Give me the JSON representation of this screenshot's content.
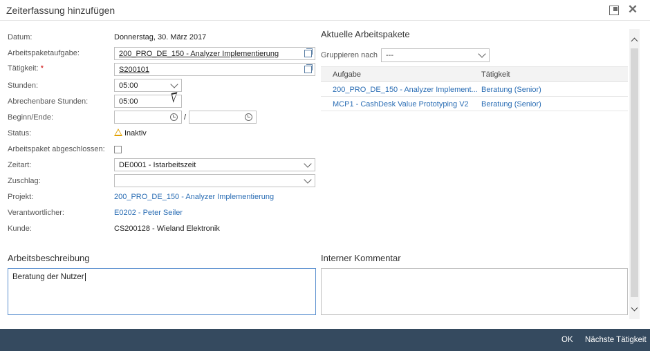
{
  "dialog": {
    "title": "Zeiterfassung hinzufügen"
  },
  "form": {
    "datum_label": "Datum:",
    "datum_value": "Donnerstag, 30. März 2017",
    "arbeitspaketaufgabe_label": "Arbeitspaketaufgabe:",
    "arbeitspaketaufgabe_value": "200_PRO_DE_150 - Analyzer Implementierung",
    "taetigkeit_label": "Tätigkeit:",
    "required_marker": "*",
    "taetigkeit_value": "S200101",
    "stunden_label": "Stunden:",
    "stunden_value": "05:00",
    "abrechenbare_label": "Abrechenbare Stunden:",
    "abrechenbare_value": "05:00",
    "beginn_ende_label": "Beginn/Ende:",
    "beginn_value": "",
    "separator": "/",
    "ende_value": "",
    "status_label": "Status:",
    "status_value": "Inaktiv",
    "abgeschlossen_label": "Arbeitspaket abgeschlossen:",
    "zeitart_label": "Zeitart:",
    "zeitart_value": "DE0001 - Istarbeitszeit",
    "zuschlag_label": "Zuschlag:",
    "zuschlag_value": "",
    "projekt_label": "Projekt:",
    "projekt_value": "200_PRO_DE_150 - Analyzer Implementierung",
    "verantwortlicher_label": "Verantwortlicher:",
    "verantwortlicher_value": "E0202 - Peter Seiler",
    "kunde_label": "Kunde:",
    "kunde_value": "CS200128 - Wieland Elektronik"
  },
  "packages": {
    "heading": "Aktuelle Arbeitspakete",
    "group_label": "Gruppieren nach",
    "group_value": "---",
    "columns": [
      "Aufgabe",
      "Tätigkeit"
    ],
    "rows": [
      [
        "200_PRO_DE_150 - Analyzer Implement...",
        "Beratung (Senior)"
      ],
      [
        "MCP1 - CashDesk Value Prototyping V2",
        "Beratung (Senior)"
      ]
    ]
  },
  "description": {
    "heading": "Arbeitsbeschreibung",
    "value": "Beratung der Nutzer"
  },
  "comment": {
    "heading": "Interner Kommentar",
    "value": ""
  },
  "footer": {
    "ok_label": "OK",
    "next_label": "Nächste Tätigkeit"
  },
  "colors": {
    "link": "#2a6db4",
    "footer_bg": "#354a5f",
    "warning": "#e2a100",
    "required": "#cc0000"
  },
  "icons": [
    "maximize-icon",
    "close-icon",
    "value-help-icon",
    "chevron-down-icon",
    "clock-icon",
    "warning-icon"
  ]
}
